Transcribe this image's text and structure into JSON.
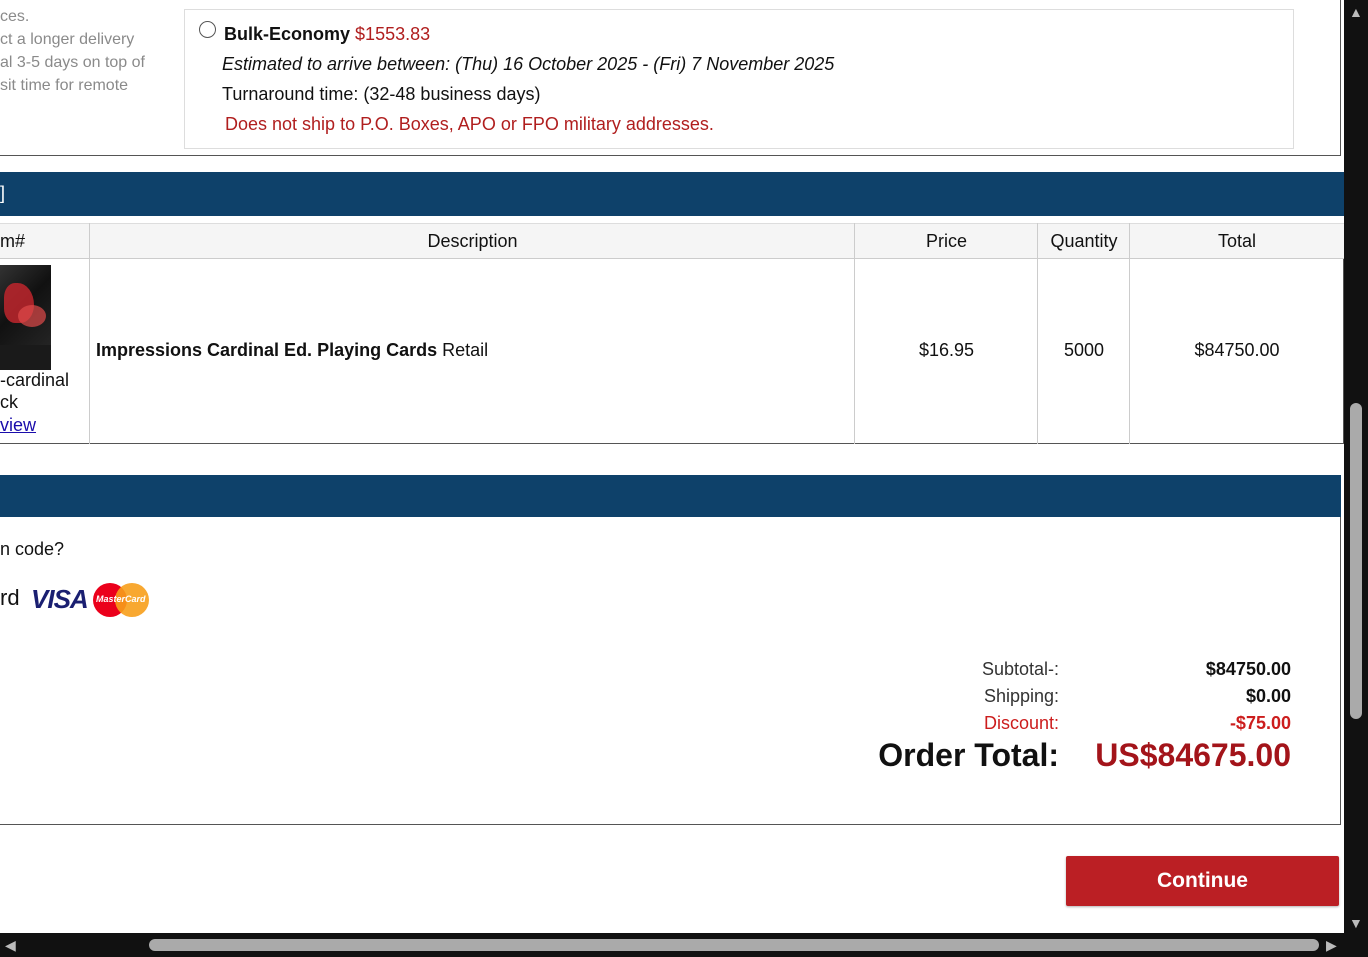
{
  "left_note": {
    "lines": [
      "ces.",
      "ct a longer delivery",
      "al 3-5 days on top of",
      "sit time for remote"
    ]
  },
  "shipping_option": {
    "name": "Bulk-Economy",
    "price": "$1553.83",
    "eta": "Estimated to arrive between: (Thu) 16 October 2025 - (Fri) 7 November 2025",
    "turnaround": "Turnaround time: (32-48 business days)",
    "warning": "Does not ship to P.O. Boxes, APO or FPO military addresses."
  },
  "cart_header": {
    "text": "]"
  },
  "table": {
    "headers": {
      "item": "m#",
      "description": "Description",
      "price": "Price",
      "quantity": "Quantity",
      "total": "Total"
    },
    "row": {
      "image_label_1": "-cardinal",
      "image_label_2": "ck",
      "view_link": "view",
      "name": "Impressions Cardinal Ed. Playing Cards",
      "variant": "Retail",
      "price": "$16.95",
      "quantity": "5000",
      "total": "$84750.00"
    }
  },
  "payment": {
    "coupon_prompt": "n code?",
    "card_label": "rd",
    "visa_text": "VISA",
    "mastercard_text": "MasterCard"
  },
  "summary": {
    "subtotal_label": "Subtotal-:",
    "subtotal": "$84750.00",
    "shipping_label": "Shipping:",
    "shipping": "$0.00",
    "discount_label": "Discount:",
    "discount": "-$75.00",
    "order_total_label": "Order Total:",
    "order_total": "US$84675.00"
  },
  "continue_label": "Continue",
  "colors": {
    "header_blue": "#0e416a",
    "accent_red": "#bb1f24",
    "price_red": "#b01e1e"
  }
}
